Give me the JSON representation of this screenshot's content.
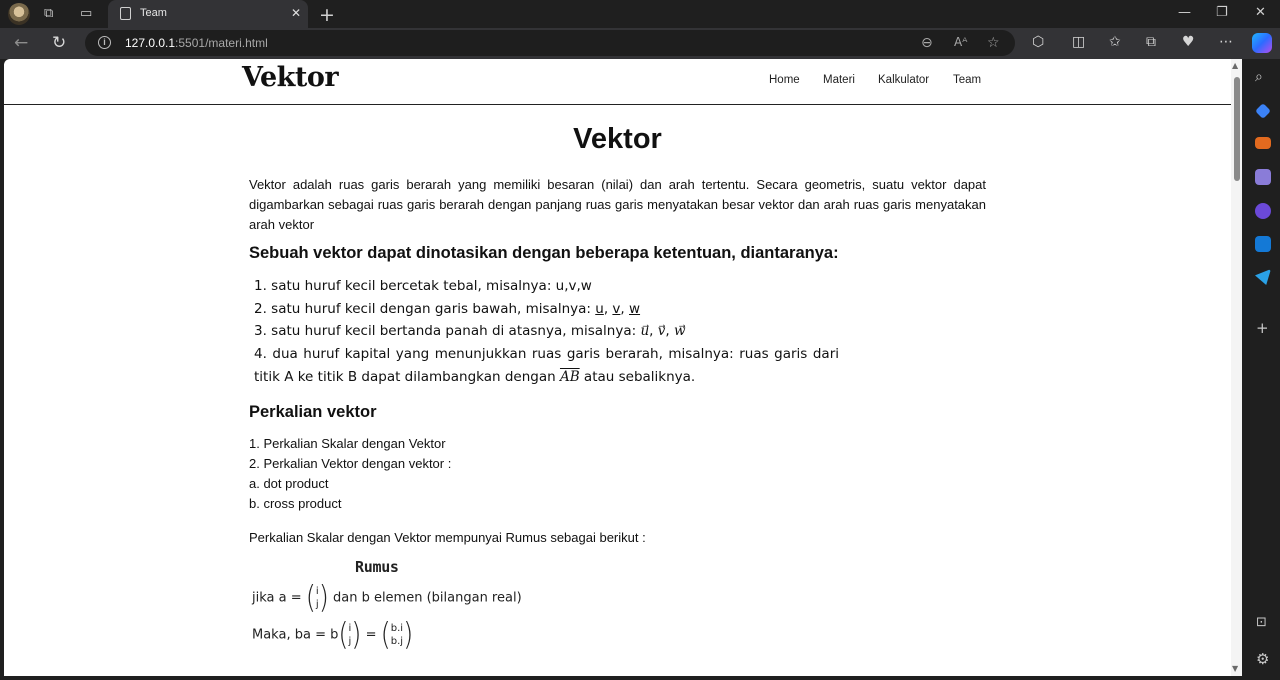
{
  "browser": {
    "tab_title": "Team",
    "url_host": "127.0.0.1",
    "url_path": ":5501/materi.html"
  },
  "site": {
    "logo": "Vektor",
    "nav": [
      "Home",
      "Materi",
      "Kalkulator",
      "Team"
    ]
  },
  "page": {
    "title": "Vektor",
    "intro": "Vektor adalah ruas garis berarah yang memiliki besaran (nilai) dan arah tertentu. Secara geometris, suatu vektor dapat digambarkan sebagai ruas garis berarah dengan panjang ruas garis menyatakan besar vektor dan arah ruas garis menyatakan arah vektor",
    "notation_heading": "Sebuah vektor dapat dinotasikan dengan beberapa ketentuan, diantaranya:",
    "notation": {
      "item1": "1. satu huruf kecil bercetak tebal, misalnya: u,v,w",
      "item2_prefix": "2. satu huruf kecil dengan garis bawah, misalnya: ",
      "item2_vars": [
        "u",
        "v",
        "w"
      ],
      "item3_prefix": "3. satu huruf kecil bertanda panah di atasnya, misalnya: ",
      "item3_vars": [
        "u",
        "v",
        "w"
      ],
      "item4_prefix": "4. dua huruf kapital yang menunjukkan ruas garis berarah, misalnya: ruas garis dari titik A ke titik B dapat dilambangkan dengan ",
      "item4_var": "AB",
      "item4_suffix": " atau sebaliknya."
    },
    "multiplication_heading": "Perkalian vektor",
    "multiplication_items": [
      "1. Perkalian Skalar dengan Vektor",
      "2. Perkalian Vektor dengan vektor :",
      "a. dot product",
      "b. cross product"
    ],
    "formula_intro": "Perkalian Skalar dengan Vektor mempunyai Rumus sebagai berikut :",
    "formula": {
      "title": "Rumus",
      "line1_prefix": "jika a = ",
      "line1_matrix": [
        "i",
        "j"
      ],
      "line1_suffix": " dan b elemen (bilangan real)",
      "line2_prefix": "Maka, ba = b",
      "line2_matrix": [
        "i",
        "j"
      ],
      "line2_eq": " = ",
      "line2_result": [
        "b.i",
        "b.j"
      ]
    }
  }
}
